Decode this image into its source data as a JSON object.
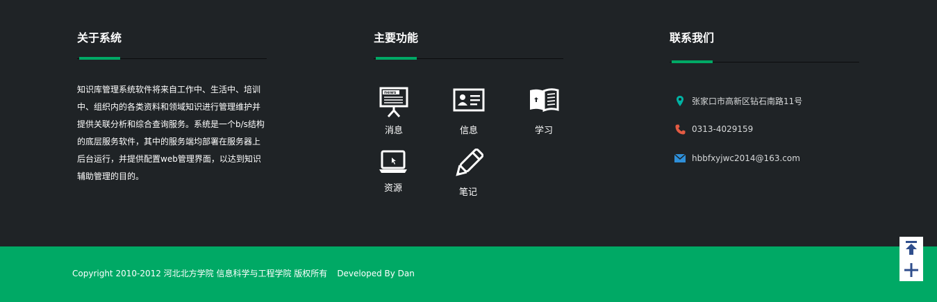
{
  "about": {
    "title": "关于系统",
    "text": "知识库管理系统软件将来自工作中、生活中、培训中、组织内的各类资料和领域知识进行管理维护并提供关联分析和综合查询服务。系统是一个b/s结构的底层服务软件，其中的服务端均部署在服务器上后台运行，并提供配置web管理界面，以达到知识辅助管理的目的。"
  },
  "functions": {
    "title": "主要功能",
    "items": [
      {
        "label": "消息",
        "icon": "news-board-icon"
      },
      {
        "label": "信息",
        "icon": "id-card-icon"
      },
      {
        "label": "学习",
        "icon": "open-book-icon"
      },
      {
        "label": "资源",
        "icon": "laptop-icon"
      },
      {
        "label": "笔记",
        "icon": "pencil-icon"
      }
    ]
  },
  "contact": {
    "title": "联系我们",
    "address": "张家口市高新区钻石南路11号",
    "phone": "0313-4029159",
    "email": "hbbfxyjwc2014@163.com",
    "colors": {
      "address_icon": "#00b3a4",
      "phone_icon": "#e35b43",
      "email_icon": "#2e8fd8"
    }
  },
  "footer": {
    "copyright": "Copyright 2010-2012 河北北方学院 信息科学与工程学院 版权所有",
    "developer": "Developed By Dan"
  },
  "float_tools": {
    "top_icon": "back-to-top-icon",
    "plus_icon": "plus-icon",
    "color": "#2f4e8c"
  },
  "colors": {
    "accent": "#00a965",
    "background": "#1f2326"
  }
}
